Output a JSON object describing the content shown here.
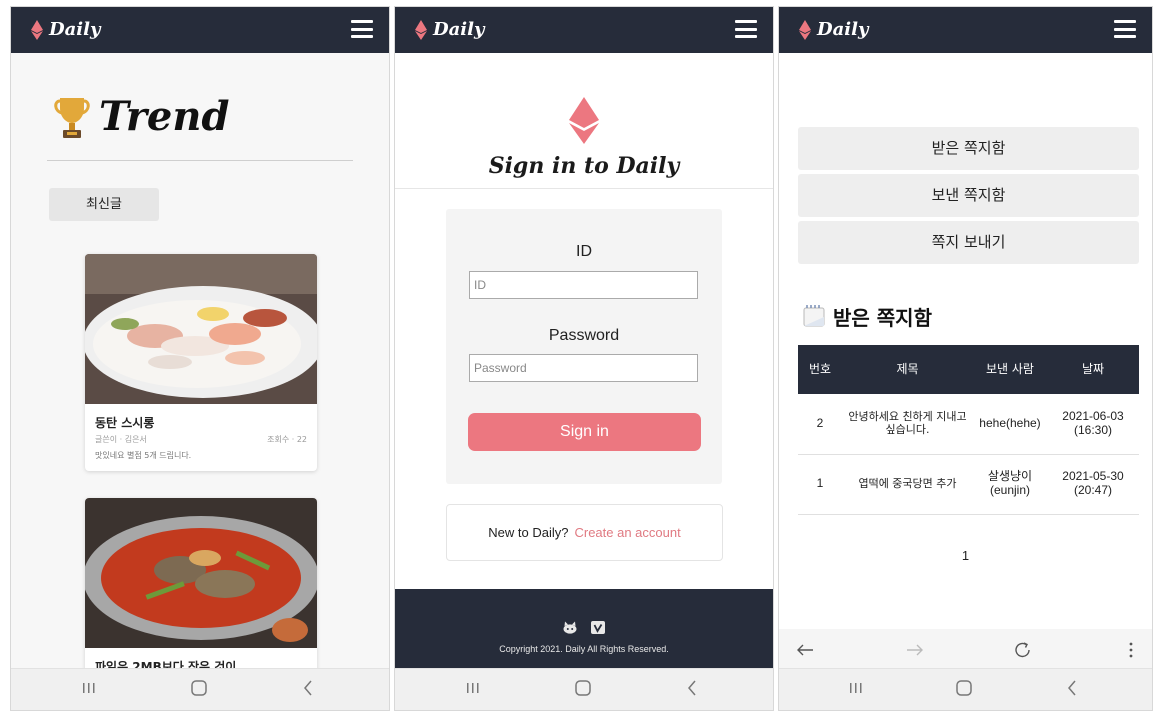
{
  "brand": {
    "name": "Daily",
    "accent": "#ec7780",
    "dark": "#262c3a"
  },
  "icons": {
    "menu": "hamburger-icon",
    "logo": "ethereum-diamond-icon",
    "trophy": "trophy-icon",
    "memo": "memo-icon"
  },
  "trend_screen": {
    "title": "Trend",
    "latest_button": "최신글",
    "posts": [
      {
        "title": "동탄 스시롱",
        "author": "글쓴이 · 김은서",
        "views": "조회수 · 22",
        "excerpt": "맛있네요 별점 5개 드립니다."
      },
      {
        "title": "파일은 2MB보다 작은 것이"
      }
    ]
  },
  "signin_screen": {
    "title": "Sign in to Daily",
    "id_label": "ID",
    "id_placeholder": "ID",
    "password_label": "Password",
    "password_placeholder": "Password",
    "signin_button": "Sign in",
    "new_text": "New to Daily?",
    "create_link": "Create an account",
    "copyright": "Copyright 2021. Daily All Rights Reserved."
  },
  "message_screen": {
    "buttons": [
      "받은 쪽지함",
      "보낸 쪽지함",
      "쪽지 보내기"
    ],
    "inbox_title": "받은 쪽지함",
    "columns": [
      "번호",
      "제목",
      "보낸 사람",
      "날짜"
    ],
    "rows": [
      {
        "no": "2",
        "title": "안녕하세요 친하게 지내고 싶습니다.",
        "sender": "hehe(hehe)",
        "date": "2021-06-03 (16:30)"
      },
      {
        "no": "1",
        "title": "엽떡에 중국당면 추가",
        "sender": "살생냥이 (eunjin)",
        "date": "2021-05-30 (20:47)"
      }
    ],
    "page": "1"
  }
}
